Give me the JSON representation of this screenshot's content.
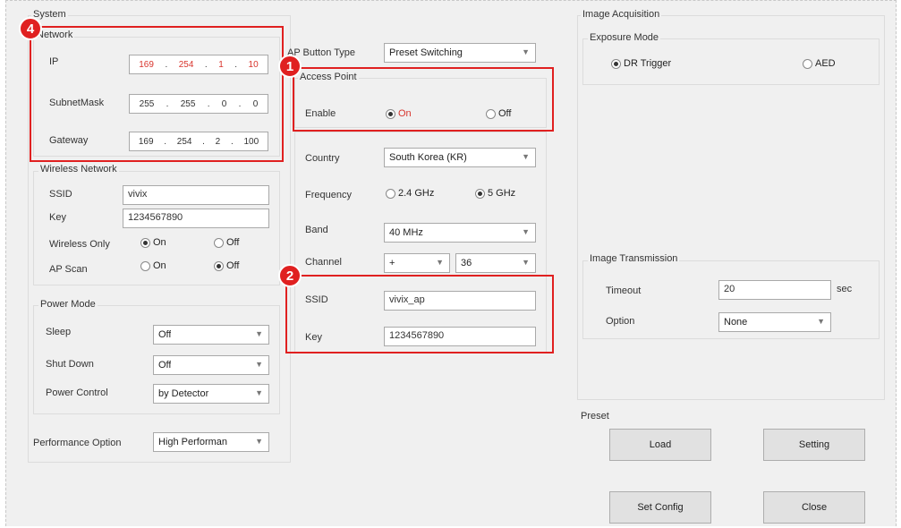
{
  "system": {
    "title": "System",
    "network": {
      "title": "Network",
      "ip_label": "IP",
      "ip": [
        "169",
        "254",
        "1",
        "10"
      ],
      "subnet_label": "SubnetMask",
      "subnet": [
        "255",
        "255",
        "0",
        "0"
      ],
      "gateway_label": "Gateway",
      "gateway": [
        "169",
        "254",
        "2",
        "100"
      ]
    },
    "wireless": {
      "title": "Wireless Network",
      "ssid_label": "SSID",
      "ssid": "vivix",
      "key_label": "Key",
      "key": "1234567890",
      "wireless_only_label": "Wireless Only",
      "ap_scan_label": "AP Scan",
      "on": "On",
      "off": "Off"
    },
    "power": {
      "title": "Power Mode",
      "sleep_label": "Sleep",
      "sleep": "Off",
      "shutdown_label": "Shut Down",
      "shutdown": "Off",
      "control_label": "Power Control",
      "control": "by Detector"
    },
    "performance_label": "Performance Option",
    "performance": "High Performan"
  },
  "ap": {
    "button_type_label": "AP Button Type",
    "button_type": "Preset Switching",
    "access_point": {
      "title": "Access Point",
      "enable_label": "Enable",
      "on": "On",
      "off": "Off"
    },
    "country_label": "Country",
    "country": "South Korea (KR)",
    "frequency_label": "Frequency",
    "freq_24": "2.4 GHz",
    "freq_5": "5 GHz",
    "band_label": "Band",
    "band": "40 MHz",
    "channel_label": "Channel",
    "channel_offset": "+",
    "channel": "36",
    "ssid_label": "SSID",
    "ssid": "vivix_ap",
    "key_label": "Key",
    "key": "1234567890"
  },
  "image_acq": {
    "title": "Image Acquisition",
    "exposure_title": "Exposure Mode",
    "dr_trigger": "DR Trigger",
    "aed": "AED"
  },
  "image_tx": {
    "title": "Image Transmission",
    "timeout_label": "Timeout",
    "timeout": "20",
    "unit": "sec",
    "option_label": "Option",
    "option": "None"
  },
  "preset": {
    "title": "Preset",
    "load": "Load",
    "setting": "Setting"
  },
  "buttons": {
    "set_config": "Set Config",
    "close": "Close"
  },
  "badges": {
    "b1": "1",
    "b2": "2",
    "b4": "4"
  },
  "colors": {
    "highlight": "#e02020",
    "ip_text": "#d8342c"
  }
}
